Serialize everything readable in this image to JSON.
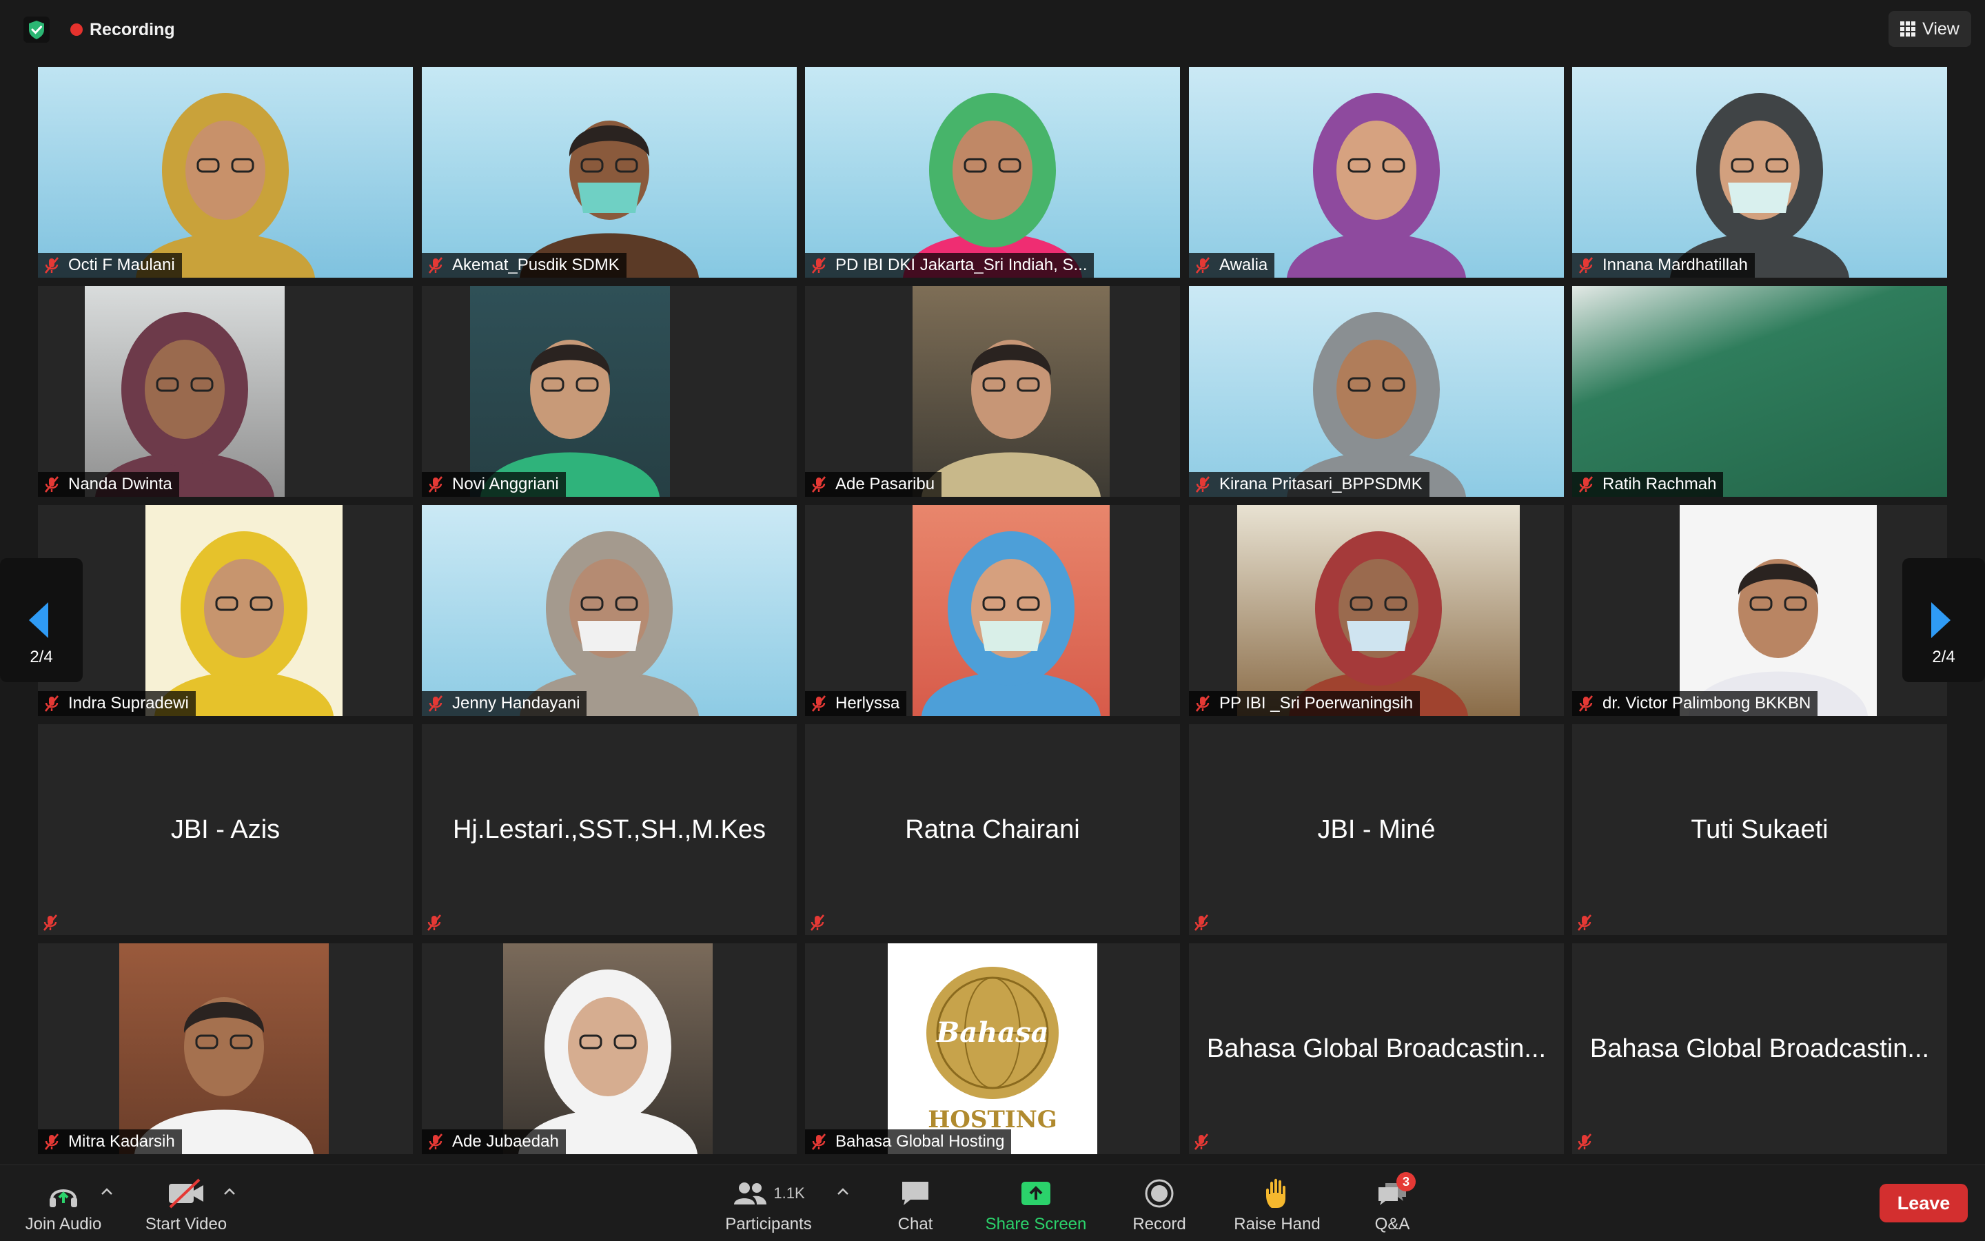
{
  "topbar": {
    "recording_label": "Recording",
    "view_label": "View"
  },
  "pager": {
    "page_label": "2/4"
  },
  "colors": {
    "background": "#1a1a1a",
    "tile": "#262626",
    "recording": "#e5322d",
    "shield": "#2bb673",
    "muted": "#e53935",
    "share": "#2bd26b",
    "leave": "#d32f2f",
    "raise_hand": "#f5b82e"
  },
  "participants": [
    {
      "name": "Octi F Maulani",
      "video": true,
      "muted": true
    },
    {
      "name": "Akemat_Pusdik SDMK",
      "video": true,
      "muted": true
    },
    {
      "name": "PD IBI DKI Jakarta_Sri Indiah, S...",
      "video": true,
      "muted": true
    },
    {
      "name": "Awalia",
      "video": true,
      "muted": true
    },
    {
      "name": "Innana Mardhatillah",
      "video": true,
      "muted": true
    },
    {
      "name": "Nanda Dwinta",
      "video": true,
      "muted": true
    },
    {
      "name": "Novi Anggriani",
      "video": true,
      "muted": true
    },
    {
      "name": "Ade Pasaribu",
      "video": true,
      "muted": true
    },
    {
      "name": "Kirana Pritasari_BPPSDMK",
      "video": true,
      "muted": true
    },
    {
      "name": "Ratih Rachmah",
      "video": true,
      "muted": true
    },
    {
      "name": "Indra Supradewi",
      "video": true,
      "muted": true
    },
    {
      "name": "Jenny Handayani",
      "video": true,
      "muted": true
    },
    {
      "name": "Herlyssa",
      "video": true,
      "muted": true
    },
    {
      "name": "PP IBI _Sri Poerwaningsih",
      "video": true,
      "muted": true
    },
    {
      "name": "dr. Victor Palimbong BKKBN",
      "video": true,
      "muted": true
    },
    {
      "name": "JBI - Azis",
      "video": false,
      "muted": true
    },
    {
      "name": "Hj.Lestari.,SST.,SH.,M.Kes",
      "video": false,
      "muted": true
    },
    {
      "name": "Ratna Chairani",
      "video": false,
      "muted": true
    },
    {
      "name": "JBI - Miné",
      "video": false,
      "muted": true
    },
    {
      "name": "Tuti Sukaeti",
      "video": false,
      "muted": true
    },
    {
      "name": "Mitra Kadarsih",
      "video": true,
      "muted": true
    },
    {
      "name": "Ade Jubaedah",
      "video": true,
      "muted": true
    },
    {
      "name": "Bahasa Global Hosting",
      "video": true,
      "muted": true
    },
    {
      "name": "Bahasa Global Broadcastin...",
      "video": false,
      "muted": true
    },
    {
      "name": "Bahasa Global Broadcastin...",
      "video": false,
      "muted": true
    }
  ],
  "logo_tile": {
    "logo_text": "Bahasa",
    "logo_caption": "HOSTING"
  },
  "toolbar": {
    "join_audio": "Join Audio",
    "start_video": "Start Video",
    "participants": "Participants",
    "participants_count": "1.1K",
    "chat": "Chat",
    "share_screen": "Share Screen",
    "record": "Record",
    "raise_hand": "Raise Hand",
    "qa": "Q&A",
    "qa_badge": "3",
    "leave": "Leave"
  }
}
